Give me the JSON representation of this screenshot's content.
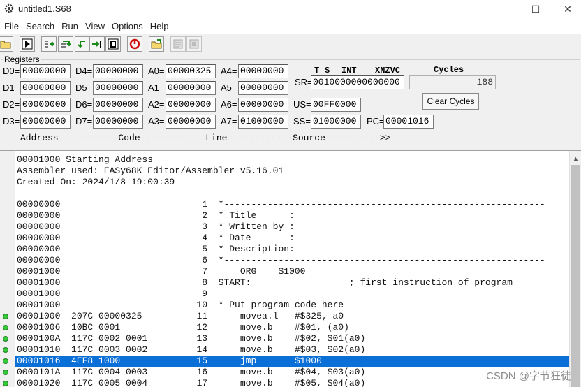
{
  "window": {
    "title": "untitled1.S68",
    "minimize": "—",
    "maximize": "☐",
    "close": "✕"
  },
  "menu": [
    "File",
    "Search",
    "Run",
    "View",
    "Options",
    "Help"
  ],
  "registers": {
    "group_label": "Registers",
    "D0": "00000000",
    "D1": "00000000",
    "D2": "00000000",
    "D3": "00000000",
    "D4": "00000000",
    "D5": "00000000",
    "D6": "00000000",
    "D7": "00000000",
    "A0": "00000325",
    "A1": "00000000",
    "A2": "00000000",
    "A3": "00000000",
    "A4": "00000000",
    "A5": "00000000",
    "A6": "00000000",
    "A7": "01000000",
    "SR": "0010000000000000",
    "US": "00FF0000",
    "SS": "01000000",
    "PC": "00001016",
    "sr_header": {
      "t": "T",
      "s": "S",
      "int": "INT",
      "xnzvc": "XNZVC"
    }
  },
  "cycles": {
    "label": "Cycles",
    "value": "188",
    "clear_label": "Clear Cycles"
  },
  "column_header": "Address   --------Code---------   Line  ----------Source---------->>",
  "listing": [
    {
      "text": "00001000 Starting Address",
      "bp": false,
      "sel": false
    },
    {
      "text": "Assembler used: EASy68K Editor/Assembler v5.16.01",
      "bp": false,
      "sel": false
    },
    {
      "text": "Created On: 2024/1/8 19:00:39",
      "bp": false,
      "sel": false
    },
    {
      "text": "",
      "bp": false,
      "sel": false
    },
    {
      "text": "00000000                          1  *-----------------------------------------------------------",
      "bp": false,
      "sel": false
    },
    {
      "text": "00000000                          2  * Title      :",
      "bp": false,
      "sel": false
    },
    {
      "text": "00000000                          3  * Written by :",
      "bp": false,
      "sel": false
    },
    {
      "text": "00000000                          4  * Date       :",
      "bp": false,
      "sel": false
    },
    {
      "text": "00000000                          5  * Description:",
      "bp": false,
      "sel": false
    },
    {
      "text": "00000000                          6  *-----------------------------------------------------------",
      "bp": false,
      "sel": false
    },
    {
      "text": "00001000                          7      ORG    $1000",
      "bp": false,
      "sel": false
    },
    {
      "text": "00001000                          8  START:                  ; first instruction of program",
      "bp": false,
      "sel": false
    },
    {
      "text": "00001000                          9",
      "bp": false,
      "sel": false
    },
    {
      "text": "00001000                         10  * Put program code here",
      "bp": false,
      "sel": false
    },
    {
      "text": "00001000  207C 00000325          11      movea.l   #$325, a0",
      "bp": true,
      "sel": false
    },
    {
      "text": "00001006  10BC 0001              12      move.b    #$01, (a0)",
      "bp": true,
      "sel": false
    },
    {
      "text": "0000100A  117C 0002 0001         13      move.b    #$02, $01(a0)",
      "bp": true,
      "sel": false
    },
    {
      "text": "00001010  117C 0003 0002         14      move.b    #$03, $02(a0)",
      "bp": true,
      "sel": false
    },
    {
      "text": "00001016  4EF8 1000              15      jmp       $1000",
      "bp": true,
      "sel": true
    },
    {
      "text": "0000101A  117C 0004 0003         16      move.b    #$04, $03(a0)",
      "bp": true,
      "sel": false
    },
    {
      "text": "00001020  117C 0005 0004         17      move.b    #$05, $04(a0)",
      "bp": true,
      "sel": false
    }
  ],
  "watermark": "CSDN @字节狂徒"
}
